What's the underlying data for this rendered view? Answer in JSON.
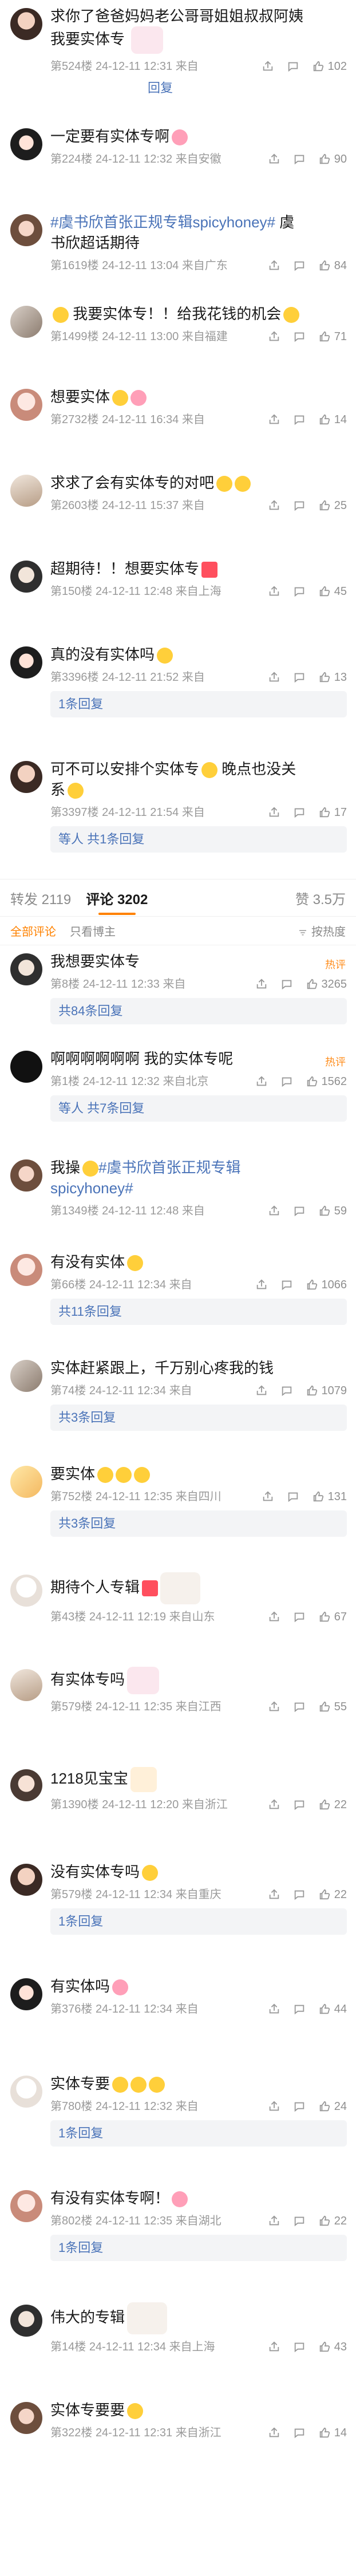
{
  "top_section": [
    {
      "text": "求你了爸爸妈妈老公哥哥姐姐叔叔阿姨 我要实体专",
      "floor": "第524楼",
      "time": "24-12-11 12:31",
      "loc": "来自",
      "reply": "",
      "likes": "102",
      "reply_label": "回复"
    },
    {
      "text": "一定要有实体专啊",
      "floor": "第224楼",
      "time": "24-12-11 12:32",
      "loc": "来自安徽",
      "reply": "",
      "likes": "90"
    },
    {
      "text_topic": "#虞书欣首张正规专辑spicyhoney#",
      "text_after": "虞书欣超话期待",
      "floor": "第1619楼",
      "time": "24-12-11 13:04",
      "loc": "来自广东",
      "reply": "",
      "likes": "84"
    },
    {
      "text": "我要实体专！！给我花钱的机会",
      "floor": "第1499楼",
      "time": "24-12-11 13:00",
      "loc": "来自福建",
      "reply": "",
      "likes": "71"
    },
    {
      "text": "想要实体",
      "floor": "第2732楼",
      "time": "24-12-11 16:34",
      "loc": "来自",
      "reply": "",
      "likes": "14"
    },
    {
      "text": "求求了会有实体专的对吧",
      "floor": "第2603楼",
      "time": "24-12-11 15:37",
      "loc": "来自",
      "reply": "",
      "likes": "25"
    },
    {
      "text": "超期待！！想要实体专",
      "floor": "第150楼",
      "time": "24-12-11 12:48",
      "loc": "来自上海",
      "reply": "",
      "likes": "45"
    },
    {
      "text": "真的没有实体吗",
      "floor": "第3396楼",
      "time": "24-12-11 21:52",
      "loc": "来自",
      "reply": "",
      "likes": "13",
      "replies": "1条回复"
    },
    {
      "text": "可不可以安排个实体专",
      "text2": "晚点也没关系",
      "floor": "第3397楼",
      "time": "24-12-11 21:54",
      "loc": "来自",
      "reply": "",
      "likes": "17",
      "replies": "等人 共1条回复"
    }
  ],
  "tabbar": {
    "repost": "转发 2119",
    "comments": "评论 3202",
    "likes": "赞 3.5万"
  },
  "filter": {
    "all": "全部评论",
    "only_friends": "只看博主",
    "sort": "按热度"
  },
  "hot_label": "热评",
  "comments": [
    {
      "text": "我想要实体专",
      "floor": "第8楼",
      "time": "24-12-11 12:33",
      "loc": "来自",
      "likes": "3265",
      "replies": "共84条回复",
      "hot": true
    },
    {
      "text": "啊啊啊啊啊啊 我的实体专呢",
      "floor": "第1楼",
      "time": "24-12-11 12:32",
      "loc": "来自北京",
      "likes": "1562",
      "replies": "等人 共7条回复",
      "hot": true
    },
    {
      "text_before": "我操",
      "text_topic": "#虞书欣首张正规专辑spicyhoney#",
      "floor": "第1349楼",
      "time": "24-12-11 12:48",
      "loc": "来自",
      "likes": "59"
    },
    {
      "text": "有没有实体",
      "floor": "第66楼",
      "time": "24-12-11 12:34",
      "loc": "来自",
      "likes": "1066",
      "replies": "共11条回复"
    },
    {
      "text": "实体赶紧跟上，千万别心疼我的钱",
      "floor": "第74楼",
      "time": "24-12-11 12:34",
      "loc": "来自",
      "likes": "1079",
      "replies": "共3条回复"
    },
    {
      "text": "要实体",
      "floor": "第752楼",
      "time": "24-12-11 12:35",
      "loc": "来自四川",
      "likes": "131",
      "replies": "共3条回复"
    },
    {
      "text": "期待个人专辑",
      "floor": "第43楼",
      "time": "24-12-11 12:19",
      "loc": "来自山东",
      "likes": "67"
    },
    {
      "text": "有实体专吗",
      "floor": "第579楼",
      "time": "24-12-11 12:35",
      "loc": "来自江西",
      "likes": "55"
    },
    {
      "text": "1218见宝宝",
      "floor": "第1390楼",
      "time": "24-12-11 12:20",
      "loc": "来自浙江",
      "likes": "22"
    },
    {
      "text": "没有实体专吗",
      "floor": "第579楼",
      "time": "24-12-11 12:34",
      "loc": "来自重庆",
      "likes": "22",
      "replies": "1条回复"
    },
    {
      "text": "有实体吗",
      "floor": "第376楼",
      "time": "24-12-11 12:34",
      "loc": "来自",
      "likes": "44"
    },
    {
      "text": "实体专要",
      "floor": "第780楼",
      "time": "24-12-11 12:32",
      "loc": "来自",
      "likes": "24",
      "replies": "1条回复"
    },
    {
      "text": "有没有实体专啊！",
      "floor": "第802楼",
      "time": "24-12-11 12:35",
      "loc": "来自湖北",
      "likes": "22",
      "replies": "1条回复"
    },
    {
      "text": "伟大的专辑",
      "floor": "第14楼",
      "time": "24-12-11 12:34",
      "loc": "来自上海",
      "likes": "43"
    },
    {
      "text": "实体专要要",
      "floor": "第322楼",
      "time": "24-12-11 12:31",
      "loc": "来自浙江",
      "likes": "14"
    }
  ],
  "reply_label": "回复"
}
